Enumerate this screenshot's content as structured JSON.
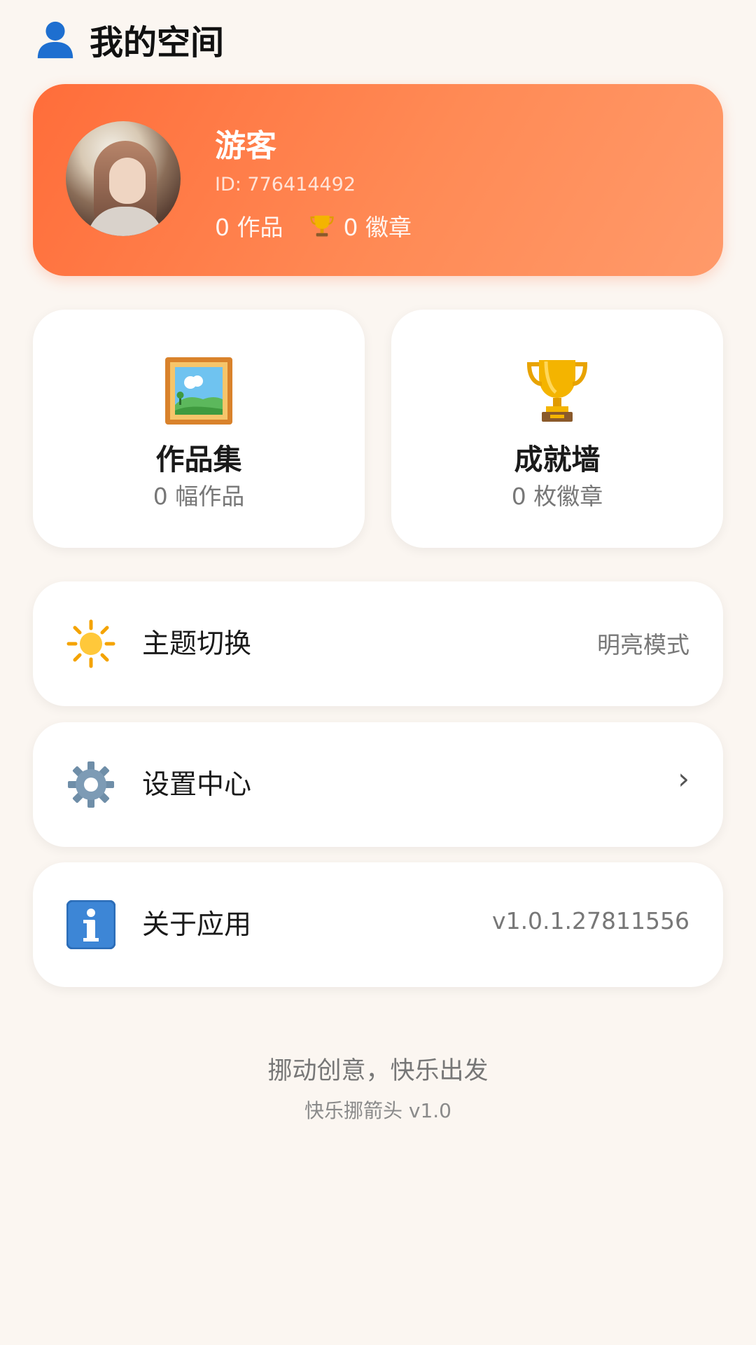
{
  "header": {
    "title": "我的空间",
    "icon": "user-silhouette-icon"
  },
  "profile": {
    "name": "游客",
    "id_text": "ID: 776414492",
    "works_text": "0 作品",
    "badges_text": "0 徽章",
    "gradient_colors": [
      "#ff6d3a",
      "#ff9a6a"
    ]
  },
  "features": {
    "gallery": {
      "title": "作品集",
      "subtitle": "0 幅作品",
      "icon": "framed-picture-icon"
    },
    "achievements": {
      "title": "成就墙",
      "subtitle": "0 枚徽章",
      "icon": "trophy-icon"
    }
  },
  "menu": {
    "theme": {
      "label": "主题切换",
      "value": "明亮模式",
      "icon": "sun-icon"
    },
    "settings": {
      "label": "设置中心",
      "chevron": "›",
      "icon": "gear-icon"
    },
    "about": {
      "label": "关于应用",
      "value": "v1.0.1.27811556",
      "icon": "info-icon"
    }
  },
  "footer": {
    "slogan": "挪动创意，快乐出发",
    "version": "快乐挪箭头 v1.0"
  }
}
